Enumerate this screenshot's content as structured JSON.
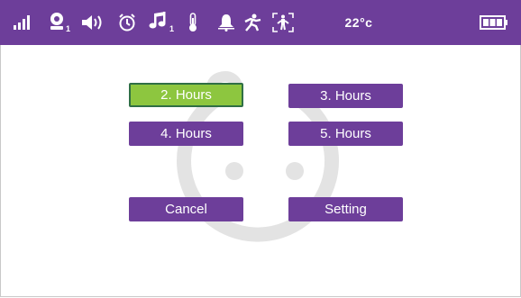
{
  "status_bar": {
    "baby_unit_index": "1",
    "music_index": "1",
    "temperature": "22°c",
    "colors": {
      "bar": "#6d3e9a",
      "icon": "#ffffff"
    },
    "icons": [
      "signal-icon",
      "baby-monitor-icon",
      "speaker-icon",
      "alarm-clock-icon",
      "music-note-icon",
      "thermometer-icon",
      "bell-icon",
      "motion-icon",
      "walk-zone-icon",
      "battery-icon"
    ]
  },
  "options": {
    "hours_2": "2. Hours",
    "hours_3": "3. Hours",
    "hours_4": "4. Hours",
    "hours_5": "5. Hours",
    "selected": "2. Hours"
  },
  "actions": {
    "cancel": "Cancel",
    "setting": "Setting"
  },
  "colors": {
    "button": "#6d3e9a",
    "selected": "#8dc63f",
    "selected_border": "#2f6f45",
    "watermark": "#e3e3e3"
  }
}
